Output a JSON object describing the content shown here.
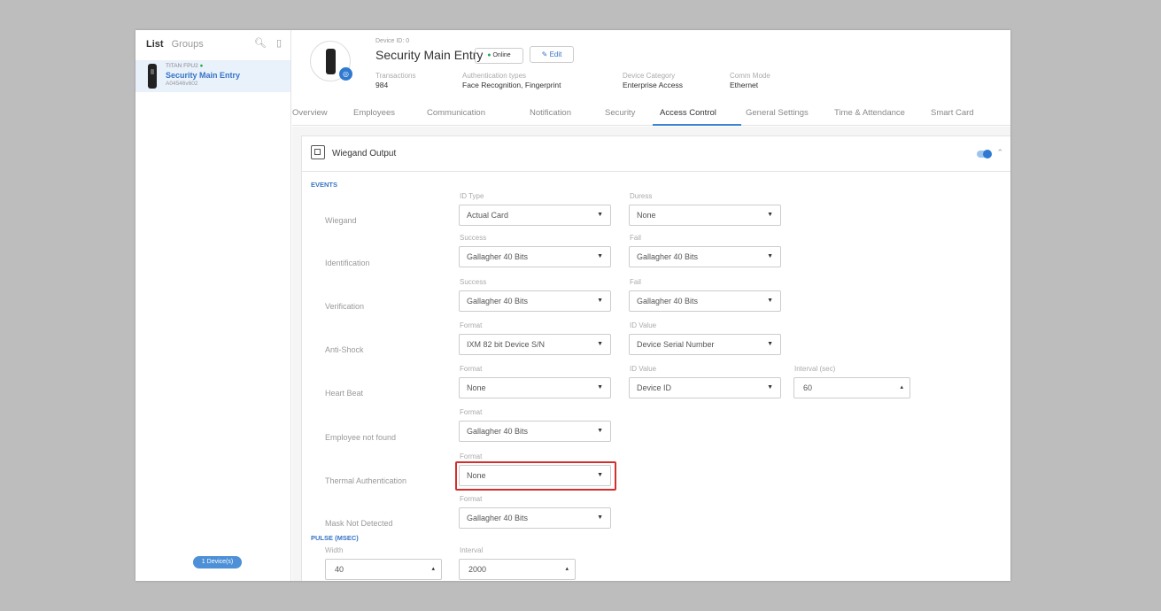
{
  "sidebar": {
    "tab_list": "List",
    "tab_groups": "Groups",
    "device": {
      "model": "TITAN FPU2",
      "name": "Security Main Entry",
      "serial": "A04546v602"
    },
    "count_label": "1 Device(s)"
  },
  "header": {
    "device_id": "Device ID: 0",
    "title": "Security Main Entry",
    "status": "Online",
    "edit_label": "Edit",
    "meta": [
      {
        "label": "Transactions",
        "value": "984"
      },
      {
        "label": "Authentication types",
        "value": "Face Recognition, Fingerprint"
      },
      {
        "label": "Device Category",
        "value": "Enterprise Access"
      },
      {
        "label": "Comm Mode",
        "value": "Ethernet"
      }
    ]
  },
  "tabs": [
    "Overview",
    "Employees",
    "Communication",
    "Notification",
    "Security",
    "Access Control",
    "General Settings",
    "Time & Attendance",
    "Smart Card"
  ],
  "active_tab": "Access Control",
  "panel": {
    "title": "Wiegand Output",
    "section_events": "EVENTS",
    "section_pulse": "PULSE (MSEC)"
  },
  "rows": [
    {
      "label": "Wiegand",
      "f1_label": "ID Type",
      "f1_value": "Actual Card",
      "f2_label": "Duress",
      "f2_value": "None"
    },
    {
      "label": "Identification",
      "f1_label": "Success",
      "f1_value": "Gallagher 40 Bits",
      "f2_label": "Fail",
      "f2_value": "Gallagher 40 Bits"
    },
    {
      "label": "Verification",
      "f1_label": "Success",
      "f1_value": "Gallagher 40 Bits",
      "f2_label": "Fail",
      "f2_value": "Gallagher 40 Bits"
    },
    {
      "label": "Anti-Shock",
      "f1_label": "Format",
      "f1_value": "IXM 82 bit Device S/N",
      "f2_label": "ID Value",
      "f2_value": "Device Serial Number"
    },
    {
      "label": "Heart Beat",
      "f1_label": "Format",
      "f1_value": "None",
      "f2_label": "ID Value",
      "f2_value": "Device ID",
      "f3_label": "Interval (sec)",
      "f3_value": "60"
    },
    {
      "label": "Employee not found",
      "f1_label": "Format",
      "f1_value": "Gallagher 40 Bits"
    },
    {
      "label": "Thermal Authentication",
      "f1_label": "Format",
      "f1_value": "None"
    },
    {
      "label": "Mask Not Detected",
      "f1_label": "Format",
      "f1_value": "Gallagher 40 Bits"
    }
  ],
  "pulse": {
    "width_label": "Width",
    "width_value": "40",
    "interval_label": "Interval",
    "interval_value": "2000"
  },
  "colors": {
    "accent": "#3674c6",
    "highlight": "#d32f2f",
    "online": "#2aa84a"
  }
}
